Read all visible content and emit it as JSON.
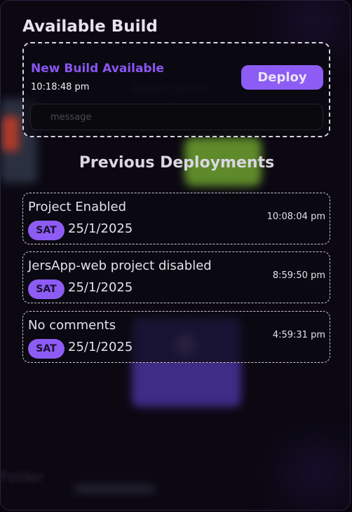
{
  "available_build": {
    "title": "Available Build",
    "status": "New Build Available",
    "time": "10:18:48 pm",
    "deploy_label": "Deploy",
    "message_placeholder": "message"
  },
  "previous": {
    "title": "Previous Deployments",
    "items": [
      {
        "message": "Project Enabled",
        "day": "SAT",
        "date": "25/1/2025",
        "time": "10:08:04 pm"
      },
      {
        "message": "JersApp-web project disabled",
        "day": "SAT",
        "date": "25/1/2025",
        "time": "8:59:50 pm"
      },
      {
        "message": "No comments",
        "day": "SAT",
        "date": "25/1/2025",
        "time": "4:59:31 pm"
      }
    ]
  },
  "colors": {
    "accent": "#8d5cf5",
    "background": "#0b0812"
  }
}
